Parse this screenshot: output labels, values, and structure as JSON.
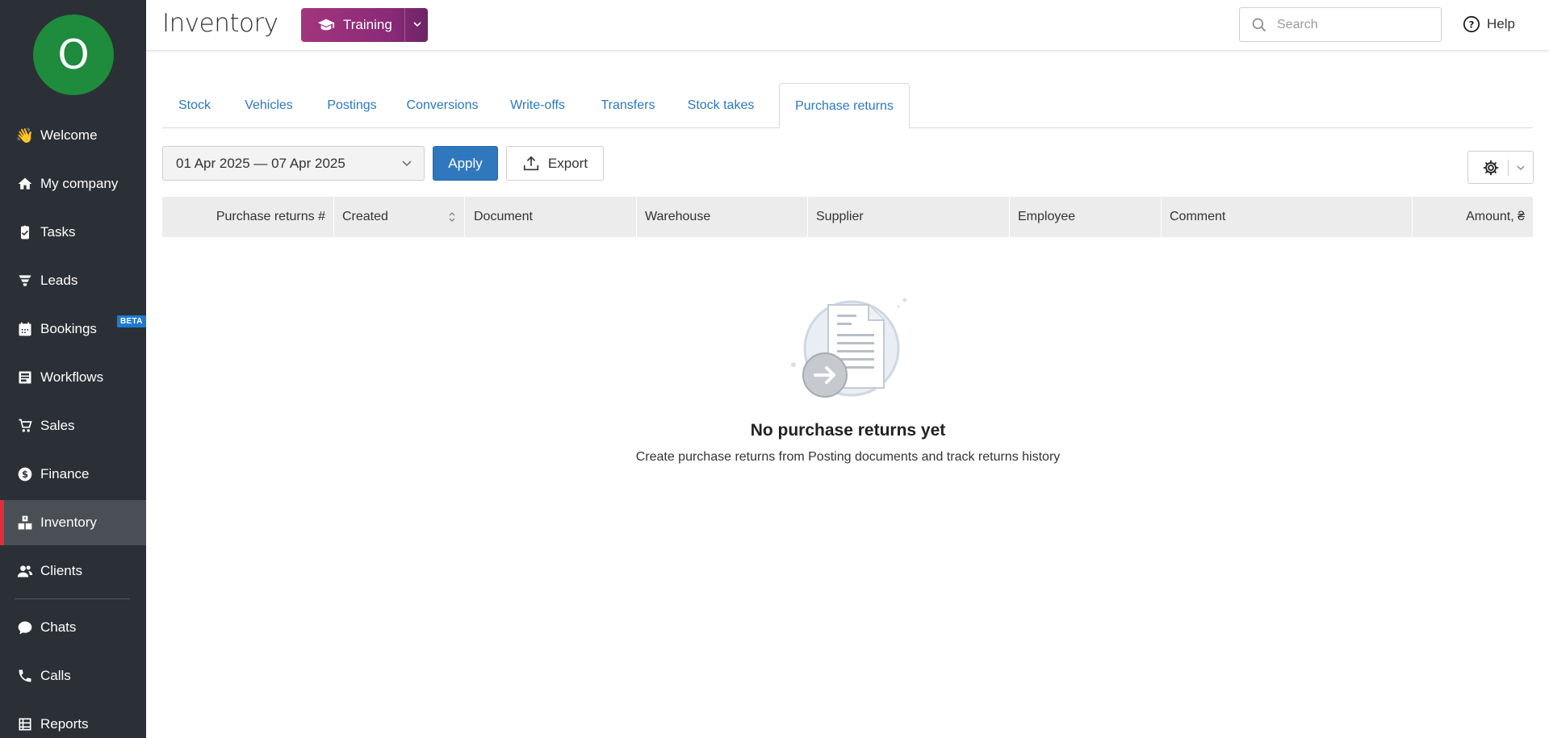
{
  "user": {
    "avatar_initial": "O",
    "avatar_color": "#1f8b3c"
  },
  "sidebar": {
    "items": [
      {
        "label": "Welcome",
        "icon": "waving-hand-icon"
      },
      {
        "label": "My company",
        "icon": "home-icon"
      },
      {
        "label": "Tasks",
        "icon": "clipboard-icon"
      },
      {
        "label": "Leads",
        "icon": "funnel-icon"
      },
      {
        "label": "Bookings",
        "icon": "calendar-icon",
        "badge": "BETA"
      },
      {
        "label": "Workflows",
        "icon": "workflow-icon"
      },
      {
        "label": "Sales",
        "icon": "cart-icon"
      },
      {
        "label": "Finance",
        "icon": "dollar-icon"
      },
      {
        "label": "Inventory",
        "icon": "boxes-icon",
        "active": true
      },
      {
        "label": "Clients",
        "icon": "users-icon"
      },
      {
        "label": "Chats",
        "icon": "chat-icon"
      },
      {
        "label": "Calls",
        "icon": "phone-icon"
      },
      {
        "label": "Reports",
        "icon": "report-icon"
      }
    ]
  },
  "header": {
    "title": "Inventory",
    "training_label": "Training",
    "search_placeholder": "Search",
    "help_label": "Help"
  },
  "tabs": [
    {
      "label": "Stock"
    },
    {
      "label": "Vehicles"
    },
    {
      "label": "Postings"
    },
    {
      "label": "Conversions"
    },
    {
      "label": "Write-offs"
    },
    {
      "label": "Transfers"
    },
    {
      "label": "Stock takes"
    },
    {
      "label": "Purchase returns",
      "active": true
    }
  ],
  "toolbar": {
    "date_range": "01 Apr 2025 — 07 Apr 2025",
    "apply_label": "Apply",
    "export_label": "Export"
  },
  "table": {
    "columns": [
      "Purchase returns #",
      "Created",
      "Document",
      "Warehouse",
      "Supplier",
      "Employee",
      "Comment",
      "Amount, ₴"
    ]
  },
  "empty_state": {
    "title": "No purchase returns yet",
    "subtitle": "Create purchase returns from Posting documents and track returns history"
  },
  "colors": {
    "sidebar_bg": "#2b3036",
    "accent_blue": "#2f78bd",
    "active_marker": "#e02d3c",
    "training_gradient_start": "#a2357e"
  }
}
